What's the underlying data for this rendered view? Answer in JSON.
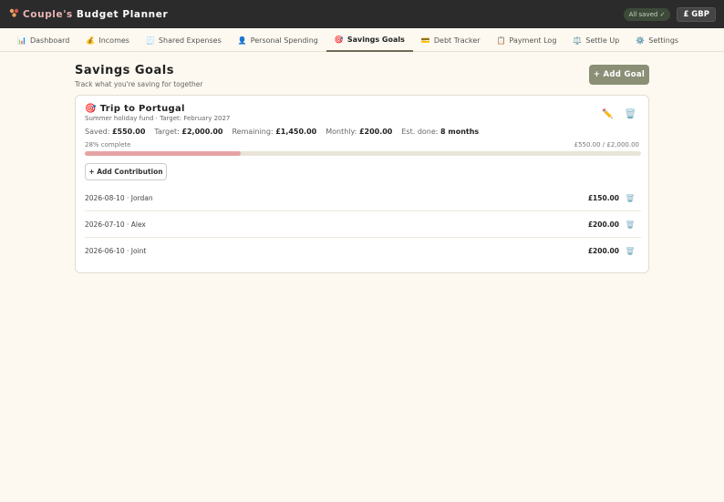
{
  "app": {
    "icon": "couple-icon",
    "title_accent": "Couple's",
    "title_rest": "Budget Planner",
    "saved_status": "All saved ✓",
    "currency": "£ GBP"
  },
  "nav": {
    "tabs": [
      {
        "icon": "📊",
        "icon_name": "chart-icon",
        "label": "Dashboard"
      },
      {
        "icon": "💰",
        "icon_name": "money-bag-icon",
        "label": "Incomes"
      },
      {
        "icon": "🧾",
        "icon_name": "receipt-icon",
        "label": "Shared Expenses"
      },
      {
        "icon": "👤",
        "icon_name": "person-icon",
        "label": "Personal Spending"
      },
      {
        "icon": "🎯",
        "icon_name": "target-icon",
        "label": "Savings Goals"
      },
      {
        "icon": "💳",
        "icon_name": "credit-card-icon",
        "label": "Debt Tracker"
      },
      {
        "icon": "📋",
        "icon_name": "clipboard-icon",
        "label": "Payment Log"
      },
      {
        "icon": "⚖️",
        "icon_name": "scales-icon",
        "label": "Settle Up"
      },
      {
        "icon": "⚙️",
        "icon_name": "gear-icon",
        "label": "Settings"
      }
    ],
    "active_tab": "Savings Goals"
  },
  "page": {
    "title": "Savings Goals",
    "subtitle": "Track what you're saving for together",
    "add_goal_label": "+ Add Goal"
  },
  "goal": {
    "icon": "🎯",
    "title": "Trip to Portugal",
    "subtitle": "Summer holiday fund · Target: February 2027",
    "stats": {
      "saved_label": "Saved:",
      "saved_value": "£550.00",
      "target_label": "Target:",
      "target_value": "£2,000.00",
      "remaining_label": "Remaining:",
      "remaining_value": "£1,450.00",
      "monthly_label": "Monthly:",
      "monthly_value": "£200.00",
      "est_label": "Est. done:",
      "est_value": "8 months"
    },
    "progress_text": "28% complete",
    "progress_fraction": 0.28,
    "progress_amount": "£550.00 / £2,000.00",
    "add_contribution_label": "+ Add Contribution",
    "contributions": [
      {
        "date_who": "2026-08-10 · Jordan",
        "amount": "£150.00"
      },
      {
        "date_who": "2026-07-10 · Alex",
        "amount": "£200.00"
      },
      {
        "date_who": "2026-06-10 · Joint",
        "amount": "£200.00"
      }
    ]
  },
  "colors": {
    "topbar": "#2b2b2b",
    "accent_button": "#8a8f76",
    "progress_fill": "#e5a3a3",
    "background": "#fdf9f0"
  }
}
